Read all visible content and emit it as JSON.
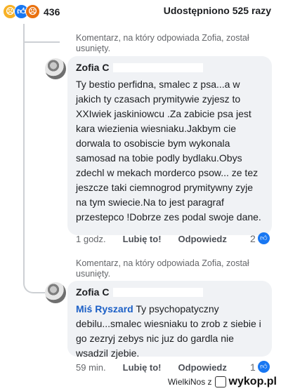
{
  "header": {
    "reaction_count": "436",
    "shares": "Udostępniono 525 razy",
    "reaction_icons": [
      "sad-icon",
      "like-icon",
      "angry-icon"
    ]
  },
  "comments": [
    {
      "deleted_note": "Komentarz, na który odpowiada Zofia, został usunięty.",
      "author": "Zofia C",
      "mention": "",
      "text": "Ty bestio perfidna, smalec z psa...a w jakich ty czasach prymitywie zyjesz to XXIwiek jaskiniowcu .Za zabicie psa jest kara wiezienia wiesniaku.Jakbym cie dorwala to osobiscie bym wykonala samosad na tobie podly bydlaku.Obys zdechl w mekach morderco psow... ze tez jeszcze taki ciemnogrod prymitywny zyje na tym swiecie.Na to jest paragraf przestepco !Dobrze zes podal swoje dane.",
      "time": "1 godz.",
      "like_label": "Lubię to!",
      "reply_label": "Odpowiedz",
      "like_count": "2"
    },
    {
      "deleted_note": "Komentarz, na który odpowiada Zofia, został usunięty.",
      "author": "Zofia C",
      "mention": "Miś Ryszard",
      "text": "Ty psychopatyczny debilu...smalec wiesniaku to zrob z siebie i go zezryj zebys nic juz do gardla nie wsadzil zjebie.",
      "time": "59 min.",
      "like_label": "Lubię to!",
      "reply_label": "Odpowiedz",
      "like_count": "1"
    }
  ],
  "watermark": {
    "user": "WielkiNos",
    "prep": "z",
    "site": "wykop.pl"
  },
  "colors": {
    "like": "#1877f2",
    "mention": "#1b5fc6",
    "bubble": "#f0f2f5"
  }
}
